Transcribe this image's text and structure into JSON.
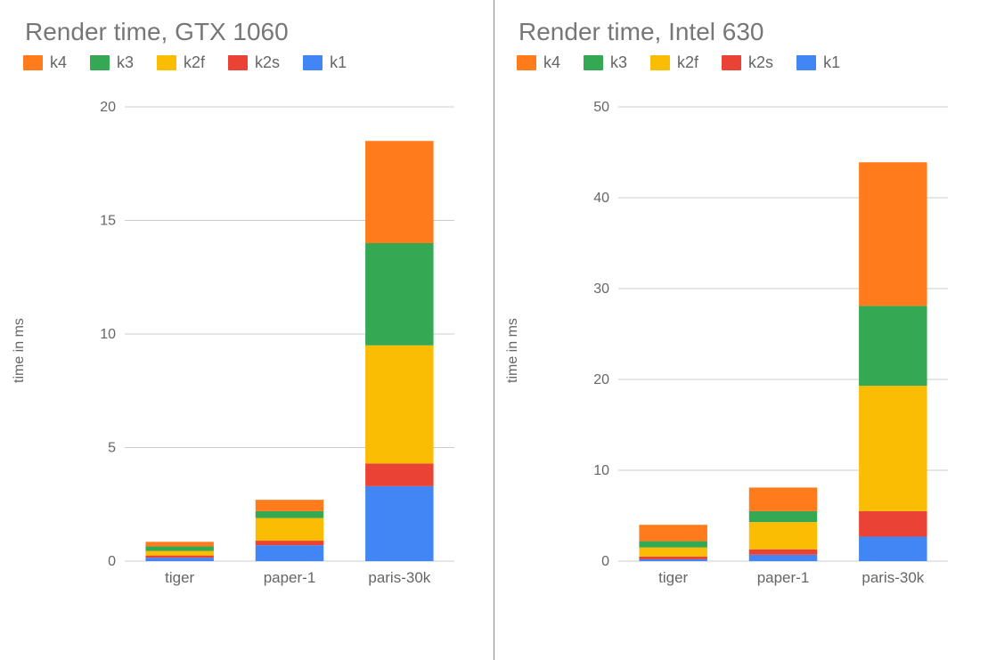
{
  "chart_data": [
    {
      "type": "bar",
      "stacked": true,
      "title": "Render time, GTX 1060",
      "xlabel": "",
      "ylabel": "time in ms",
      "ylim": [
        0,
        20
      ],
      "yticks": [
        0,
        5,
        10,
        15,
        20
      ],
      "categories": [
        "tiger",
        "paper-1",
        "paris-30k"
      ],
      "legend_position": "top",
      "series": [
        {
          "name": "k4",
          "color": "#ff7b1b",
          "values": [
            0.2,
            0.5,
            4.5
          ]
        },
        {
          "name": "k3",
          "color": "#34a853",
          "values": [
            0.2,
            0.3,
            4.5
          ]
        },
        {
          "name": "k2f",
          "color": "#fbbc04",
          "values": [
            0.2,
            1.0,
            5.2
          ]
        },
        {
          "name": "k2s",
          "color": "#ea4335",
          "values": [
            0.1,
            0.2,
            1.0
          ]
        },
        {
          "name": "k1",
          "color": "#4285f4",
          "values": [
            0.15,
            0.7,
            3.3
          ]
        }
      ]
    },
    {
      "type": "bar",
      "stacked": true,
      "title": "Render time, Intel 630",
      "xlabel": "",
      "ylabel": "time in ms",
      "ylim": [
        0,
        50
      ],
      "yticks": [
        0,
        10,
        20,
        30,
        40,
        50
      ],
      "categories": [
        "tiger",
        "paper-1",
        "paris-30k"
      ],
      "legend_position": "top",
      "series": [
        {
          "name": "k4",
          "color": "#ff7b1b",
          "values": [
            1.8,
            2.6,
            15.8
          ]
        },
        {
          "name": "k3",
          "color": "#34a853",
          "values": [
            0.7,
            1.2,
            8.8
          ]
        },
        {
          "name": "k2f",
          "color": "#fbbc04",
          "values": [
            1.0,
            3.0,
            13.8
          ]
        },
        {
          "name": "k2s",
          "color": "#ea4335",
          "values": [
            0.3,
            0.6,
            2.8
          ]
        },
        {
          "name": "k1",
          "color": "#4285f4",
          "values": [
            0.2,
            0.7,
            2.7
          ]
        }
      ]
    }
  ]
}
